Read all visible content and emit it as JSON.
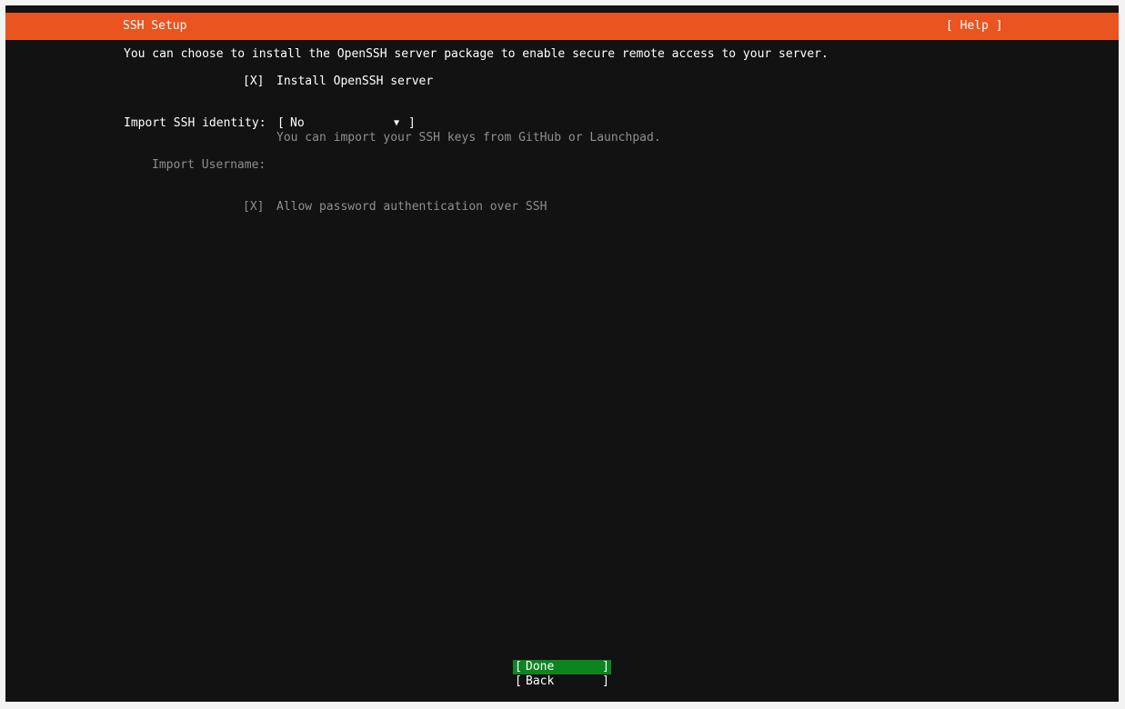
{
  "header": {
    "title": "SSH Setup",
    "help_label": "[ Help ]"
  },
  "intro": "You can choose to install the OpenSSH server package to enable secure remote access to your server.",
  "install_openssh": {
    "checkbox": "[X]",
    "label": "Install OpenSSH server",
    "checked": true
  },
  "import_identity": {
    "label": "Import SSH identity:",
    "bracket_open": "[",
    "value": "No",
    "arrow": "▼",
    "bracket_close": "]",
    "hint": "You can import your SSH keys from GitHub or Launchpad."
  },
  "import_username": {
    "label": "Import Username:",
    "value": ""
  },
  "allow_password": {
    "checkbox": "[X]",
    "label": "Allow password authentication over SSH",
    "checked": true,
    "disabled": true
  },
  "buttons": {
    "bracket_open": "[",
    "bracket_close": "]",
    "done": "Done",
    "back": "Back"
  },
  "colors": {
    "header": "#e95420",
    "background": "#121212",
    "focused_button": "#0e8420",
    "dim_text": "#8f8f8f"
  }
}
